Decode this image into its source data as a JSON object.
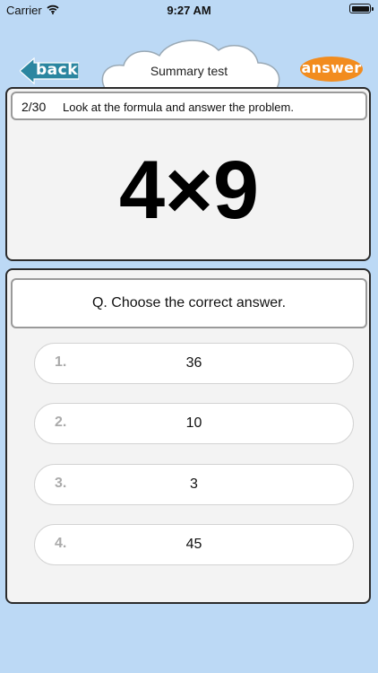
{
  "status_bar": {
    "carrier": "Carrier",
    "time": "9:27 AM"
  },
  "header": {
    "back_label": "back",
    "title": "Summary test",
    "answer_label": "answer",
    "back_color": "#2b86a0",
    "answer_color": "#f28c1e"
  },
  "question": {
    "counter": "2/30",
    "instruction": "Look at the formula and answer the problem.",
    "formula": "4×9"
  },
  "answers": {
    "prompt": "Q. Choose the correct answer.",
    "choices": [
      {
        "number": "1.",
        "value": "36"
      },
      {
        "number": "2.",
        "value": "10"
      },
      {
        "number": "3.",
        "value": "3"
      },
      {
        "number": "4.",
        "value": "45"
      }
    ]
  }
}
